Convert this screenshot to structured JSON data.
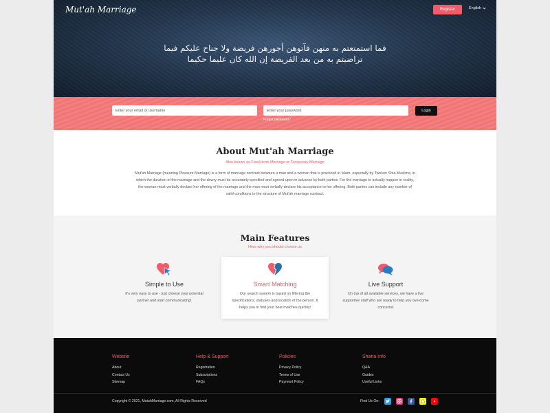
{
  "header": {
    "logo": "Mut'ah Marriage",
    "register_label": "Register",
    "language": "English"
  },
  "hero": {
    "verse_line1": "فما استمتعتم به منهن فآتوهن أجورهن فريضة ولا جناح عليكم فيما",
    "verse_line2": "تراضيتم به من بعد الفريضة إن الله كان عليما حكيما"
  },
  "login": {
    "email_placeholder": "Enter your email or username",
    "password_placeholder": "Enter your password",
    "login_label": "Login",
    "forgot_label": "Forgot password?"
  },
  "about": {
    "title": "About Mut'ah Marriage",
    "subtitle": "Also known as Fixed-term Marriage or Temporary Marriage",
    "body": "Mut'ah Marriage (meaning Pleasure Marriage) is a form of marriage contract between a man and a woman that is practiced in Islam, especially by Twelver Shia Muslims, in which the duration of the marriage and the dowry must be accurately specified and agreed upon in advance by both parties. For the marriage to actually happen in reality, the woman must verbally declare her offering of the marriage and the man must verbally declare his acceptance to her offering. Both parties can include any number of valid conditions to the structure of Mut'ah marriage contract."
  },
  "features": {
    "title": "Main Features",
    "subtitle": "Here why you should choose us",
    "items": [
      {
        "name": "Simple to Use",
        "desc": "It's very easy to use - just choose your potential partner and start communicating!",
        "icon": "heart-cursor-icon"
      },
      {
        "name": "Smart Matching",
        "desc": "Our search system is based on filtering the specifications, statuses and location of the person. It helps you to find your best matches quickly!",
        "icon": "split-heart-icon"
      },
      {
        "name": "Live Support",
        "desc": "On top of all available services, we have a live supportive staff who are ready to help you overcome concerns!",
        "icon": "chat-bubbles-icon"
      }
    ]
  },
  "footer": {
    "columns": [
      {
        "heading": "Website",
        "links": [
          "About",
          "Contact Us",
          "Sitemap"
        ]
      },
      {
        "heading": "Help & Support",
        "links": [
          "Registration",
          "Subscriptions",
          "FAQs"
        ]
      },
      {
        "heading": "Policies",
        "links": [
          "Privacy Policy",
          "Terms of Use",
          "Payment Policy"
        ]
      },
      {
        "heading": "Sharia Info",
        "links": [
          "Q&A",
          "Guides",
          "Useful Links"
        ]
      }
    ],
    "copyright": "Copyright © 2021, MutahMarriage.com, All Rights Reserved",
    "find_us": "Find Us On:",
    "social": [
      "twitter-icon",
      "instagram-icon",
      "facebook-icon",
      "snapchat-icon",
      "youtube-icon"
    ]
  },
  "colors": {
    "accent": "#f45b69",
    "hero_bg": "#24384f",
    "login_strip": "#f47f7f",
    "footer_bg": "#0b0b0b"
  }
}
